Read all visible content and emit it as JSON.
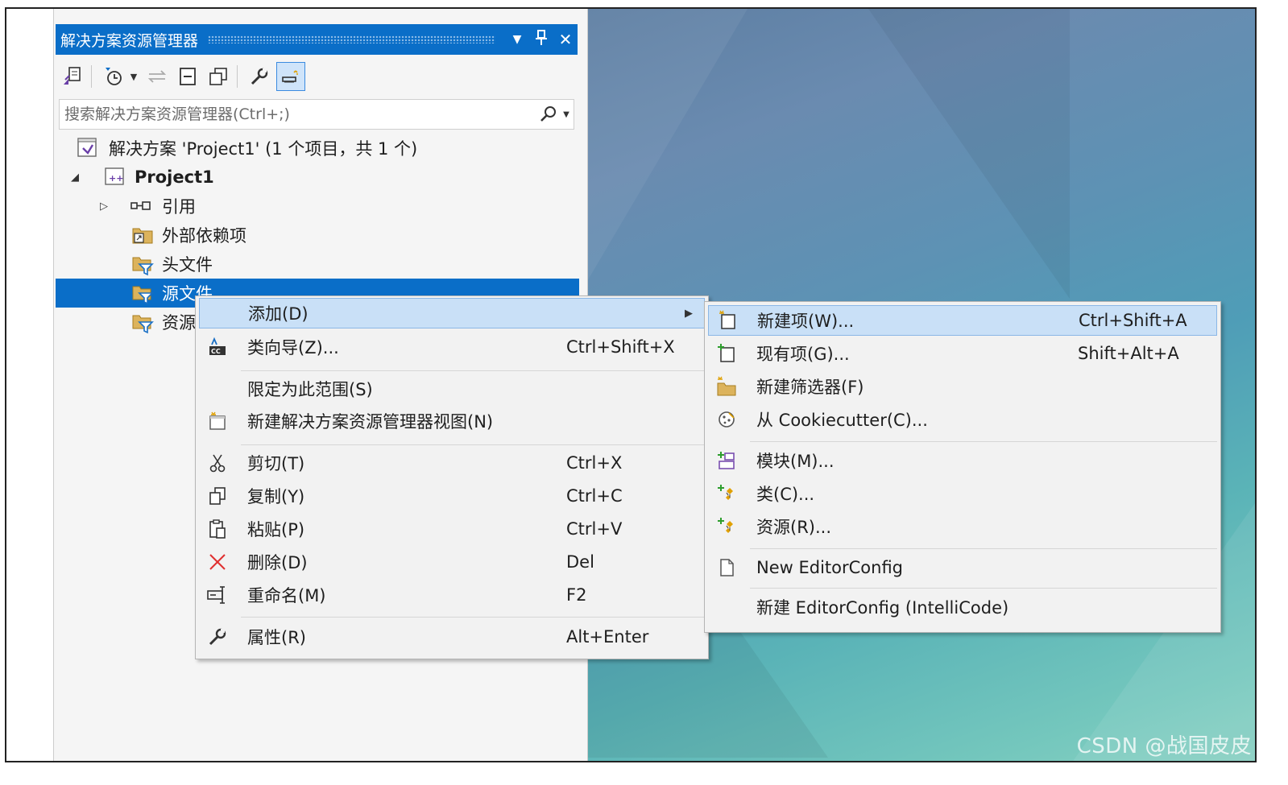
{
  "explorer": {
    "title": "解决方案资源管理器",
    "title_buttons": [
      "▼",
      "🖈",
      "✕"
    ],
    "search_placeholder": "搜索解决方案资源管理器(Ctrl+;)",
    "tree": [
      {
        "label": "解决方案 'Project1' (1 个项目，共 1 个)",
        "icon": "solution-icon",
        "expander": "",
        "bold": false,
        "selected": false
      },
      {
        "label": "Project1",
        "icon": "project-icon",
        "expander": "◢",
        "bold": true,
        "selected": false
      },
      {
        "label": "引用",
        "icon": "references-icon",
        "expander": "▷",
        "bold": false,
        "selected": false
      },
      {
        "label": "外部依赖项",
        "icon": "external-deps-icon",
        "expander": "",
        "bold": false,
        "selected": false
      },
      {
        "label": "头文件",
        "icon": "filter-folder-icon",
        "expander": "",
        "bold": false,
        "selected": false
      },
      {
        "label": "源文件",
        "icon": "filter-folder-icon",
        "expander": "",
        "bold": false,
        "selected": true
      },
      {
        "label": "资源",
        "icon": "filter-folder-icon",
        "expander": "",
        "bold": false,
        "selected": false
      }
    ]
  },
  "context_menu": {
    "items": [
      {
        "label": "添加(D)",
        "shortcut": "",
        "icon": "",
        "submenu": true
      },
      {
        "label": "类向导(Z)...",
        "shortcut": "Ctrl+Shift+X",
        "icon": "class-wizard-icon"
      },
      {
        "label": "限定为此范围(S)",
        "shortcut": "",
        "icon": ""
      },
      {
        "label": "新建解决方案资源管理器视图(N)",
        "shortcut": "",
        "icon": "new-view-icon"
      },
      {
        "label": "剪切(T)",
        "shortcut": "Ctrl+X",
        "icon": "cut-icon"
      },
      {
        "label": "复制(Y)",
        "shortcut": "Ctrl+C",
        "icon": "copy-icon"
      },
      {
        "label": "粘贴(P)",
        "shortcut": "Ctrl+V",
        "icon": "paste-icon"
      },
      {
        "label": "删除(D)",
        "shortcut": "Del",
        "icon": "delete-icon"
      },
      {
        "label": "重命名(M)",
        "shortcut": "F2",
        "icon": "rename-icon"
      },
      {
        "label": "属性(R)",
        "shortcut": "Alt+Enter",
        "icon": "properties-icon"
      }
    ]
  },
  "submenu": {
    "items": [
      {
        "label": "新建项(W)...",
        "shortcut": "Ctrl+Shift+A",
        "icon": "new-item-icon"
      },
      {
        "label": "现有项(G)...",
        "shortcut": "Shift+Alt+A",
        "icon": "existing-item-icon"
      },
      {
        "label": "新建筛选器(F)",
        "shortcut": "",
        "icon": "new-filter-icon"
      },
      {
        "label": "从 Cookiecutter(C)...",
        "shortcut": "",
        "icon": "cookiecutter-icon"
      },
      {
        "label": "模块(M)...",
        "shortcut": "",
        "icon": "module-icon"
      },
      {
        "label": "类(C)...",
        "shortcut": "",
        "icon": "class-icon"
      },
      {
        "label": "资源(R)...",
        "shortcut": "",
        "icon": "resource-icon"
      },
      {
        "label": "New EditorConfig",
        "shortcut": "",
        "icon": "editorconfig-icon"
      },
      {
        "label": "新建 EditorConfig (IntelliCode)",
        "shortcut": "",
        "icon": ""
      }
    ]
  },
  "watermark": "CSDN @战国皮皮",
  "colors": {
    "accent": "#0a6ec8",
    "highlight": "#c9e0f7",
    "menu_bg": "#f2f2f2"
  }
}
